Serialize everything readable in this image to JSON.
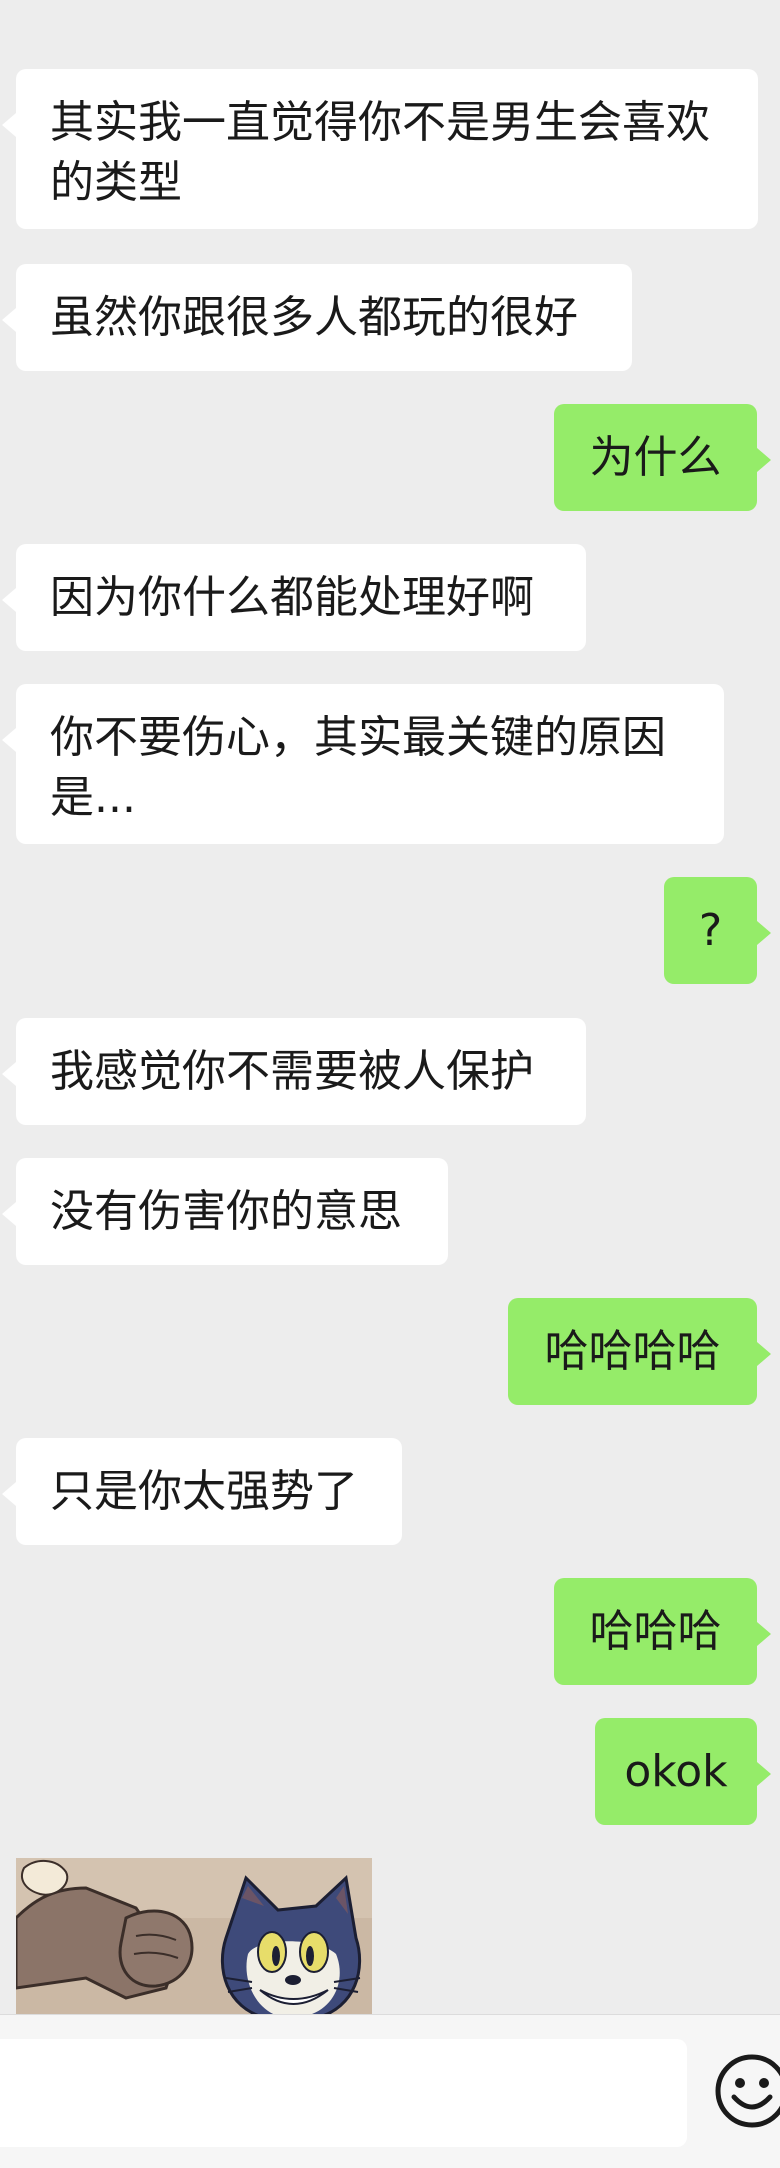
{
  "chat": {
    "messages": [
      {
        "side": "in",
        "text": "其实我一直觉得你不是男生会喜欢的类型"
      },
      {
        "side": "in",
        "text": "虽然你跟很多人都玩的很好"
      },
      {
        "side": "out",
        "text": "为什么"
      },
      {
        "side": "in",
        "text": "因为你什么都能处理好啊"
      },
      {
        "side": "in",
        "text": "你不要伤心，其实最关键的原因是..."
      },
      {
        "side": "out",
        "text": "?"
      },
      {
        "side": "in",
        "text": "我感觉你不需要被人保护"
      },
      {
        "side": "in",
        "text": "没有伤害你的意思"
      },
      {
        "side": "out",
        "text": "哈哈哈哈"
      },
      {
        "side": "in",
        "text": "只是你太强势了"
      },
      {
        "side": "out",
        "text": "哈哈哈"
      },
      {
        "side": "out",
        "text": "okok"
      }
    ],
    "sticker": {
      "subject": "tom-cat-fist-bump-sticker"
    }
  },
  "input_bar": {
    "value": "",
    "emoji_icon": "smiley-face-icon"
  },
  "colors": {
    "background": "#ededed",
    "incoming_bubble": "#ffffff",
    "outgoing_bubble": "#95ec69"
  }
}
